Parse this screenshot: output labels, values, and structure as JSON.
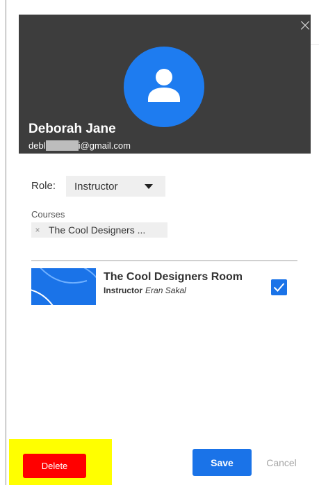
{
  "user": {
    "name": "Deborah Jane",
    "email_prefix": "debl",
    "email_suffix": "i@gmail.com",
    "avatar_icon": "user-icon",
    "avatar_color": "#1e7cf0"
  },
  "dialog": {
    "close_icon": "close-icon",
    "close_glyph": "×"
  },
  "role": {
    "label": "Role:",
    "selected": "Instructor"
  },
  "courses": {
    "label": "Courses",
    "chips": [
      {
        "remove_glyph": "×",
        "text": "The Cool Designers ..."
      }
    ],
    "list": [
      {
        "title": "The Cool Designers Room",
        "role": "Instructor",
        "instructor": "Eran Sakal",
        "checked": true
      }
    ]
  },
  "actions": {
    "delete_label": "Delete",
    "save_label": "Save",
    "cancel_label": "Cancel"
  },
  "colors": {
    "header_bg": "#3d3d3d",
    "accent": "#1a73e8",
    "delete": "#ff0000",
    "highlight": "#ffff00"
  }
}
